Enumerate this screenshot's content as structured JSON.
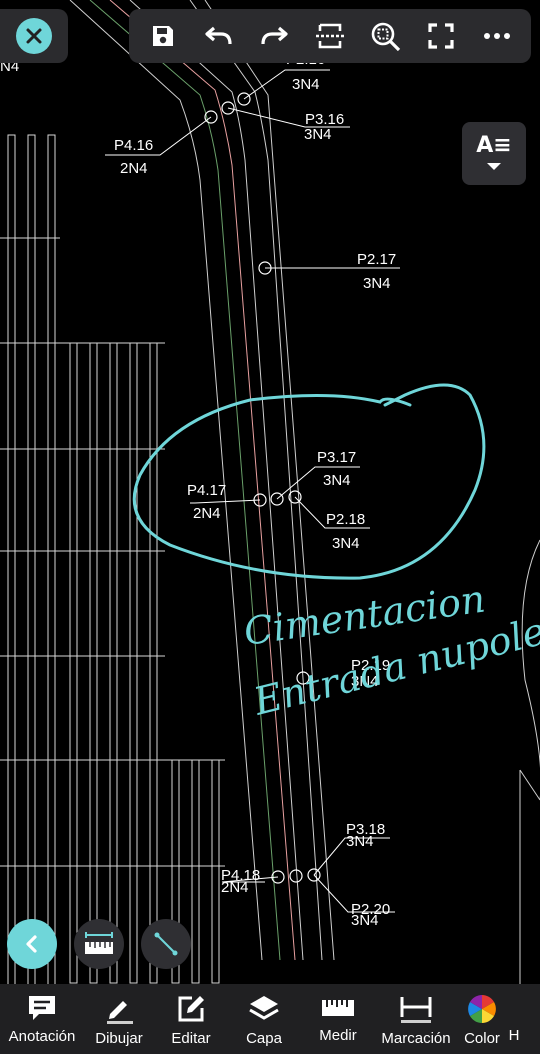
{
  "drawing": {
    "labels": [
      {
        "id": "p2-16-top",
        "text": "P2.16"
      },
      {
        "id": "n4-top",
        "text": "3N4"
      },
      {
        "id": "p3-16",
        "text": "P3.16"
      },
      {
        "id": "p3-16-sub",
        "text": "3N4"
      },
      {
        "id": "p4-16",
        "text": "P4.16"
      },
      {
        "id": "p4-16-sub",
        "text": "2N4"
      },
      {
        "id": "p2-17",
        "text": "P2.17"
      },
      {
        "id": "p2-17-sub",
        "text": "3N4"
      },
      {
        "id": "p3-17",
        "text": "P3.17"
      },
      {
        "id": "p3-17-sub",
        "text": "3N4"
      },
      {
        "id": "p4-17",
        "text": "P4.17"
      },
      {
        "id": "p4-17-sub",
        "text": "2N4"
      },
      {
        "id": "p2-18",
        "text": "P2.18"
      },
      {
        "id": "p2-18-sub",
        "text": "3N4"
      },
      {
        "id": "p2-19",
        "text": "P2.19"
      },
      {
        "id": "p2-19-sub",
        "text": "3N4"
      },
      {
        "id": "p3-18",
        "text": "P3.18"
      },
      {
        "id": "p3-18-sub",
        "text": "3N4"
      },
      {
        "id": "p4-18",
        "text": "P4.18"
      },
      {
        "id": "p4-18-sub",
        "text": "2N4"
      },
      {
        "id": "p2-20",
        "text": "P2.20"
      },
      {
        "id": "p2-20-sub",
        "text": "3N4"
      },
      {
        "id": "edge-top",
        "text": "4."
      },
      {
        "id": "edge-top-sub",
        "text": "N4"
      }
    ],
    "annotation_line1": "Cimentacion",
    "annotation_line2": "Entrada nupoles",
    "annotation_color": "#6fd6d9"
  },
  "top_toolbar": {
    "icons": [
      "save-icon",
      "undo-icon",
      "redo-icon",
      "fit-width-icon",
      "zoom-area-icon",
      "fullscreen-icon",
      "more-icon"
    ]
  },
  "text_style_button": {
    "label": "A≡"
  },
  "bottom_bar": {
    "items": [
      {
        "label": "Anotación",
        "icon": "comment-icon"
      },
      {
        "label": "Dibujar",
        "icon": "pencil-icon"
      },
      {
        "label": "Editar",
        "icon": "edit-icon"
      },
      {
        "label": "Capa",
        "icon": "layers-icon"
      },
      {
        "label": "Medir",
        "icon": "ruler-icon"
      },
      {
        "label": "Marcación",
        "icon": "dimension-icon"
      },
      {
        "label": "Color",
        "icon": "color-wheel-icon"
      },
      {
        "label": "H",
        "icon": ""
      }
    ]
  },
  "colors": {
    "accent": "#6fd6d9",
    "toolbar_bg": "#2b2b2e",
    "bottom_bg": "#202022"
  }
}
